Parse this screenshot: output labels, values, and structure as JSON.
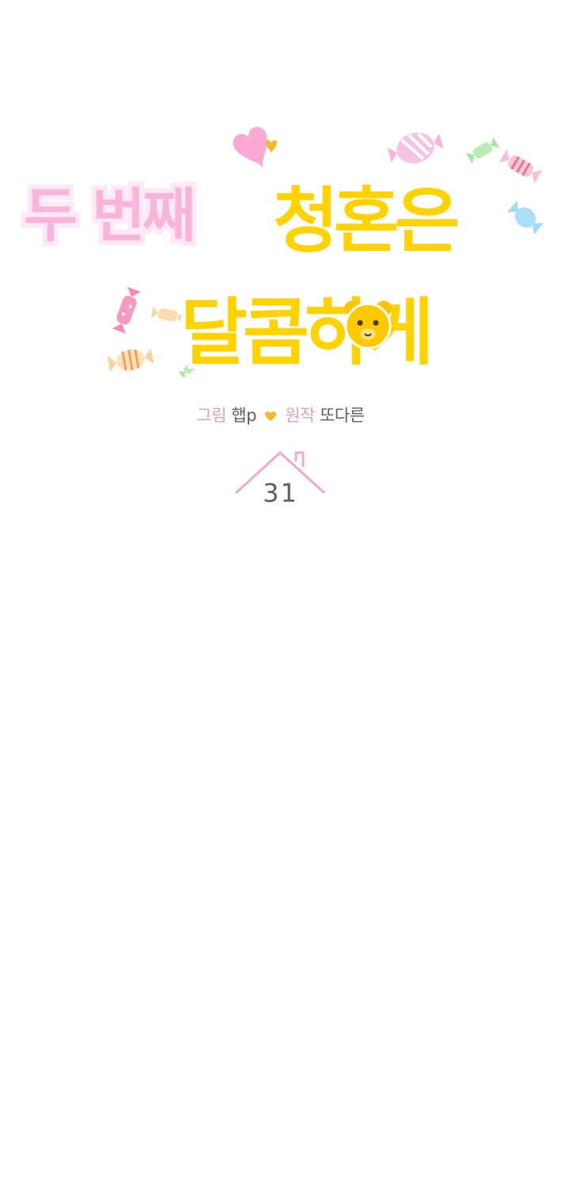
{
  "title": {
    "line1_part1": "두 번째",
    "line1_part2": "청혼은",
    "line2": "달콤하게"
  },
  "credits": {
    "art_label": "그림",
    "art_name": "햅p",
    "story_label": "원작",
    "story_name": "또다른"
  },
  "episode": "31",
  "colors": {
    "pink_title": "#f9b4d9",
    "yellow_title": "#ffd200",
    "outline": "#ffffff",
    "text_brown": "#6b5a51",
    "label_pink": "#d5a3c9",
    "heart_yellow": "#f5b921",
    "roof_pink": "#f2a7cf"
  },
  "icons": [
    "heart-icon",
    "candy-icon",
    "bear-face-icon",
    "roof-icon"
  ]
}
